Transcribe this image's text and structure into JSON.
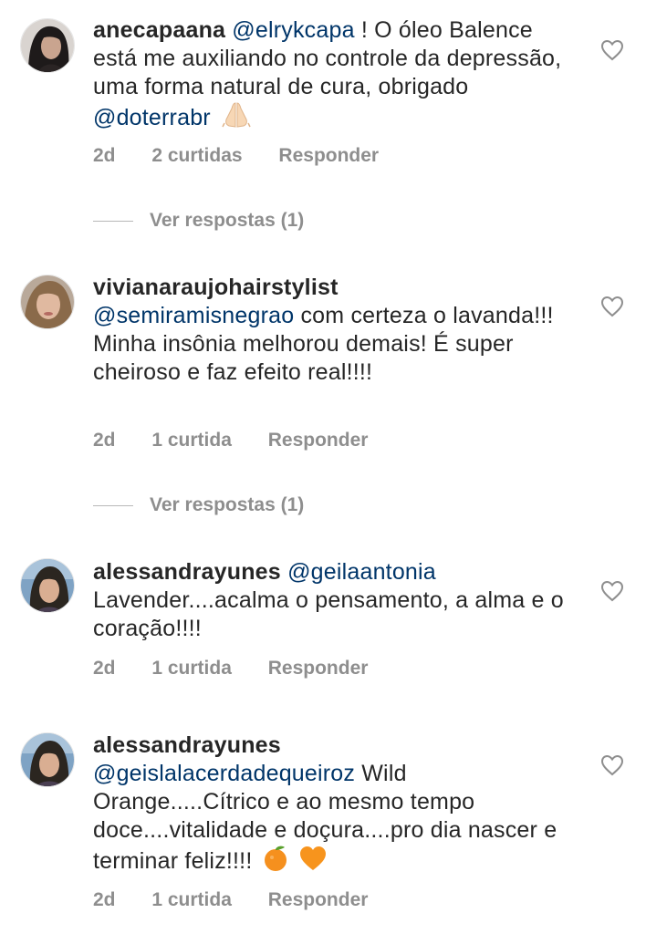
{
  "comments": [
    {
      "username": "anecapaana",
      "mention": "@elrykcapa",
      "text_parts": [
        "! O óleo Balence está me auxiliando no controle da depressão, uma forma natural de cura, obrigado",
        "@doterrabr"
      ],
      "emoji": "folded-hands",
      "time": "2d",
      "likes": "2 curtidas",
      "reply_label": "Responder",
      "view_replies": "Ver respostas (1)"
    },
    {
      "username": "vivianaraujohairstylist",
      "mention": "@semiramisnegrao",
      "text": "com certeza o lavanda!!! Minha insônia melhorou demais! É super cheiroso e faz efeito real!!!!",
      "time": "2d",
      "likes": "1 curtida",
      "reply_label": "Responder",
      "view_replies": "Ver respostas (1)"
    },
    {
      "username": "alessandrayunes",
      "mention": "@geilaantonia",
      "text": "Lavender....acalma o pensamento, a alma e o coração!!!!",
      "time": "2d",
      "likes": "1 curtida",
      "reply_label": "Responder"
    },
    {
      "username": "alessandrayunes",
      "mention": "@geislalacerdadequeiroz",
      "text": "Wild Orange.....Cítrico e ao mesmo tempo doce....vitalidade e doçura....pro dia nascer e terminar feliz!!!!",
      "emojis": [
        "tangerine",
        "orange-heart"
      ],
      "time": "2d",
      "likes": "1 curtida",
      "reply_label": "Responder"
    }
  ],
  "colors": {
    "text": "#262626",
    "mention": "#003569",
    "meta": "#8e8e8e"
  },
  "icons": [
    "heart-outline-icon"
  ]
}
